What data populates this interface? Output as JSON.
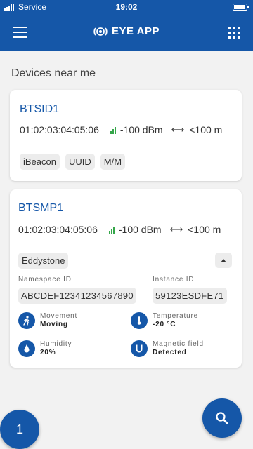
{
  "status_bar": {
    "carrier": "Service",
    "time": "19:02",
    "battery_level": 0.9
  },
  "app_bar": {
    "title": "EYE APP"
  },
  "section_title": "Devices near me",
  "devices": [
    {
      "name": "BTSID1",
      "mac": "01:02:03:04:05:06",
      "rssi": "-100 dBm",
      "distance": "<100 m",
      "tags": [
        "iBeacon",
        "UUID",
        "M/M"
      ]
    },
    {
      "name": "BTSMP1",
      "mac": "01:02:03:04:05:06",
      "rssi": "-100 dBm",
      "distance": "<100 m",
      "frame_type": "Eddystone",
      "namespace_label": "Namespace ID",
      "namespace_value": "ABCDEF12341234567890",
      "instance_label": "Instance ID",
      "instance_value": "59123ESDFE71",
      "sensors": {
        "movement": {
          "label": "Movement",
          "value": "Moving"
        },
        "temperature": {
          "label": "Temperature",
          "value": "-20 °C"
        },
        "humidity": {
          "label": "Humidity",
          "value": "20%"
        },
        "magnetic": {
          "label": "Magnetic field",
          "value": "Detected"
        }
      }
    }
  ],
  "device_count": "1",
  "colors": {
    "primary": "#1557a8",
    "signal": "#35a64a",
    "chip_bg": "#ececec",
    "background": "#f2f2f2"
  },
  "icons": [
    "signal-strength-icon",
    "battery-icon",
    "menu-icon",
    "eye-logo-icon",
    "grid-icon",
    "signal-bars-icon",
    "distance-arrows-icon",
    "chevron-up-icon",
    "walking-person-icon",
    "thermometer-icon",
    "water-drop-icon",
    "magnet-icon",
    "search-icon"
  ]
}
